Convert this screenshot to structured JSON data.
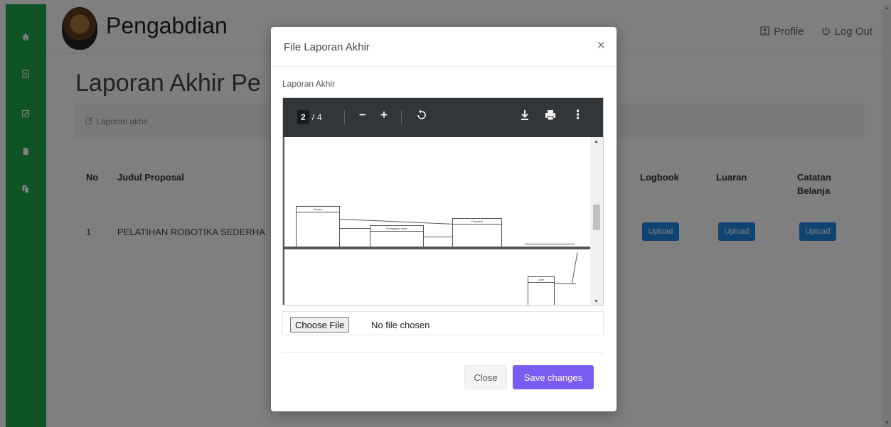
{
  "navbar": {
    "brand": "Pengabdian",
    "links": [
      {
        "label": "Profile",
        "icon": "user-card-icon"
      },
      {
        "label": "Log Out",
        "icon": "power-icon"
      }
    ]
  },
  "sidebar": {
    "icons": [
      "home-icon",
      "document-icon",
      "check-square-icon",
      "file-icon",
      "files-icon"
    ]
  },
  "page": {
    "heading": "Laporan Akhir Pe",
    "breadcrumb": "Laporan akhir"
  },
  "table": {
    "headers": {
      "no": "No",
      "judul": "Judul Proposal",
      "logbook": "Logbook",
      "luaran": "Luaran",
      "catatan": "Catatan Belanja"
    },
    "rows": [
      {
        "no": "1",
        "judul": "PELATIHAN ROBOTIKA SEDERHA",
        "logbook": "Upload",
        "luaran": "Upload",
        "catatan": "Upload"
      }
    ]
  },
  "modal": {
    "title": "File Laporan Akhir",
    "close_symbol": "×",
    "field_label": "Laporan Akhir",
    "pdf": {
      "current_page": "2",
      "total_pages": "4",
      "entities": [
        "Dosen",
        "Pengajuan mitra",
        "Proposal",
        "User"
      ]
    },
    "file_input": {
      "button_label": "Choose File",
      "status": "No file chosen"
    },
    "buttons": {
      "close": "Close",
      "save": "Save changes"
    }
  },
  "colors": {
    "sidebar": "#1ea64a",
    "upload_button": "#1e88e5",
    "save_button": "#7b5cf0"
  }
}
